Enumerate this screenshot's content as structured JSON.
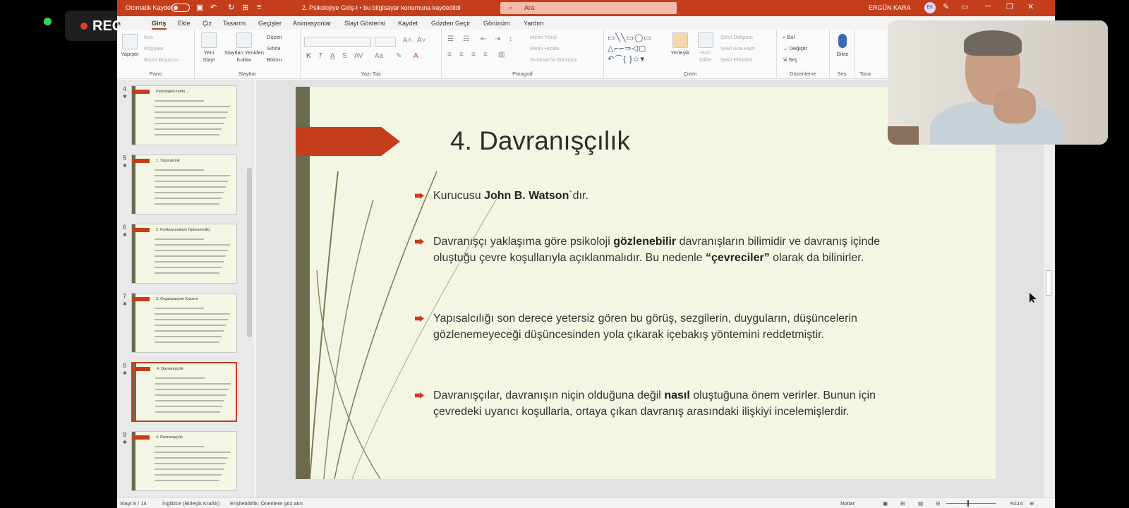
{
  "window": {
    "autosave_label": "Otomatik Kaydet",
    "doc_title": "2. Psikolojiye Giriş-I  •  bu bilgisayar konumuna kaydedildi",
    "search_placeholder": "Ara",
    "user_name": "ERGÜN KARA",
    "user_initials": "EK",
    "accent_color": "#c43e1c"
  },
  "recording": {
    "label": "REC"
  },
  "tabs": [
    "a",
    "Giriş",
    "Ekle",
    "Çiz",
    "Tasarım",
    "Geçişler",
    "Animasyonlar",
    "Slayt Gösterisi",
    "Kaydet",
    "Gözden Geçir",
    "Görünüm",
    "Yardım"
  ],
  "active_tab": "Giriş",
  "ribbon": {
    "clipboard": {
      "label": "Pano",
      "paste": "Yapıştır",
      "cut": "Kes",
      "copy": "Kopyala",
      "format_painter": "Biçim Boyacısı"
    },
    "slides": {
      "label": "Slaytlar",
      "new_slide": "Yeni Slayt",
      "reuse": "Slaytları Yeniden Kullan",
      "layout": "Düzen",
      "reset": "Sıfırla",
      "section": "Bölüm"
    },
    "font": {
      "label": "Yazı Tipi"
    },
    "paragraph": {
      "label": "Paragraf",
      "text_direction": "Metin Yönü",
      "align_text": "Metni Hizala",
      "smartart": "SmartArt'a Dönüştür"
    },
    "drawing": {
      "label": "Çizim",
      "arrange": "Yerleştir",
      "quick_styles": "Hızlı Stiller",
      "fill": "Şekil Dolgusu",
      "outline": "Şekil Ana Hattı",
      "effects": "Şekil Efektleri"
    },
    "editing": {
      "label": "Düzenleme",
      "find": "Bul",
      "replace": "Değiştir",
      "select": "Seç"
    },
    "voice": {
      "label": "Ses",
      "dictate": "Dikte"
    },
    "designer": {
      "label": "Tasa"
    }
  },
  "thumbnails": [
    {
      "num": "4",
      "title": "Psikolojinin tarihi ..."
    },
    {
      "num": "5",
      "title": "1. Yapısalcılık"
    },
    {
      "num": "6",
      "title": "2. Fonksiyonalizm (İşlevselcilik)"
    },
    {
      "num": "7",
      "title": "3. Organizasyon Kuramı"
    },
    {
      "num": "8",
      "title": "4. Davranışçılık"
    },
    {
      "num": "9",
      "title": "4. Davranışçılık"
    }
  ],
  "slide": {
    "title": "4. Davranışçılık",
    "bullets": [
      [
        {
          "t": "Kurucusu "
        },
        {
          "t": "John B. Watson",
          "b": true
        },
        {
          "t": "`dır."
        }
      ],
      [
        {
          "t": "Davranışçı yaklaşıma göre psikoloji "
        },
        {
          "t": "gözlenebilir",
          "b": true
        },
        {
          "t": " davranışların bilimidir ve davranış içinde oluştuğu çevre koşullarıyla açıklanmalıdır. Bu nedenle "
        },
        {
          "t": "“çevreciler”",
          "b": true
        },
        {
          "t": " olarak da bilinirler."
        }
      ],
      [
        {
          "t": "Yapısalcılığı son derece yetersiz gören bu görüş, sezgilerin, duyguların, düşüncelerin gözlenemeyeceği düşüncesinden yola çıkarak içebakış yöntemini reddetmiştir."
        }
      ],
      [
        {
          "t": "Davranışçılar, davranışın niçin olduğuna değil "
        },
        {
          "t": "nasıl",
          "b": true
        },
        {
          "t": " oluştuğuna önem verirler. Bunun için çevredeki uyarıcı koşullarla, ortaya çıkan davranış arasındaki ilişkiyi incelemişlerdir."
        }
      ]
    ]
  },
  "statusbar": {
    "slide_info": "Slayt 8 / 14",
    "language": "İngilizce (Birleşik Krallık)",
    "accessibility": "Erişilebilirlik: Önerilere göz atın",
    "notes": "Notlar",
    "zoom": "%114"
  }
}
